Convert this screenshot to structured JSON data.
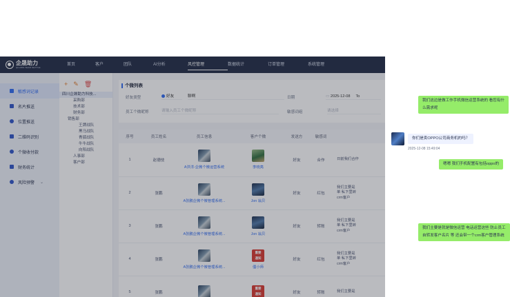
{
  "topbar": {
    "logo_text": "企晟助力",
    "logo_sub": "QILABS TEAM SETTLE",
    "nav": [
      "首页",
      "客户",
      "团队",
      "AI分析",
      "风控管理",
      "数据统计",
      "订单管理",
      "系统管理"
    ],
    "active_nav": "风控管理"
  },
  "sidebar": {
    "items": [
      {
        "label": "敏感词记录",
        "active": true
      },
      {
        "label": "名片推送"
      },
      {
        "label": "位置推送"
      },
      {
        "label": "二维码识别"
      },
      {
        "label": "个微收付款"
      },
      {
        "label": "财务统计"
      },
      {
        "label": "风险预警",
        "caret": "⌄"
      }
    ]
  },
  "tree": {
    "tools": {
      "add": "+",
      "edit": "✎",
      "delete": "🗑"
    },
    "root": "四川企晟助力科技...",
    "nodes": [
      "采购部",
      "技术部",
      "财务部",
      "销售部",
      "王牌战队",
      "黑马战队",
      "青狐战队",
      "牛牛战队",
      "向阳战队",
      "人事部",
      "客户部"
    ]
  },
  "filters": {
    "title": "个微列表",
    "friend_type_label": "好友类型",
    "friend_type_value": "好友",
    "friend_nick_label": "",
    "friend_nick_value": "聊啊",
    "date_label": "日期",
    "date_value": "2025-12-08",
    "date_to": "To",
    "staff_label": "员工个微昵称",
    "staff_placeholder": "请输入员工个微昵称",
    "group_label": "敏感词组",
    "group_placeholder": "请选择"
  },
  "table": {
    "headers": [
      "序号",
      "员工姓名",
      "员工信息",
      "客户个微",
      "发送方",
      "敏感词",
      ""
    ],
    "rows": [
      {
        "idx": "1",
        "name": "赵德伎",
        "staff": "A洪洋-企微个微运营系统",
        "customer": "李晓亮",
        "sender": "好友",
        "word": "合作",
        "remark": [
          "日前我们合作"
        ],
        "thumb": "",
        "cthumb": "pet"
      },
      {
        "idx": "2",
        "name": "张鹏",
        "staff": "A张鹏企微个微管理系统...",
        "customer": "Jon 翁贝",
        "sender": "好友",
        "word": "红包",
        "remark": [
          "我们主要是",
          "单 私下里转",
          "crm客户"
        ],
        "thumb": "",
        "cthumb": "p2"
      },
      {
        "idx": "3",
        "name": "张鹏",
        "staff": "A张鹏企微个微管理系统...",
        "customer": "Jon 翁贝",
        "sender": "好友",
        "word": "转账",
        "remark": [
          "我们主要是",
          "单 私下里转",
          "crm客户"
        ],
        "thumb": "",
        "cthumb": "p2"
      },
      {
        "idx": "4",
        "name": "张鹏",
        "staff": "A张鹏企微个微管理系统...",
        "customer": "僵小师",
        "sender": "好友",
        "word": "红包",
        "remark": [
          "我们主要是",
          "单 私下里转",
          "crm客户"
        ],
        "thumb": "",
        "cthumb": "notice",
        "cthumb_text": [
          "重要",
          "通知"
        ]
      },
      {
        "idx": "5",
        "name": "张鹏",
        "staff": "",
        "customer": "",
        "sender": "好友",
        "word": "转账",
        "remark": [
          "我们主要是"
        ],
        "thumb": "",
        "cthumb": "notice",
        "cthumb_text": [
          "重要",
          "通知"
        ]
      }
    ]
  },
  "chat": {
    "msg1": [
      "我们这边是做工作手机微信运营系统的 看您有什",
      "么需求呢"
    ],
    "msg2": "你们是卖OPPO公司商务机的吗？",
    "msg2_time": "2025-12-08 15:49:04",
    "msg3": "嗯嗯 我们手机配置有包括oppo的",
    "msg4": [
      "我们主要是就是微信运营 电话运营这些 防止员工",
      "自转发客户名片 等 还会带一个crm客户管理系统"
    ]
  }
}
